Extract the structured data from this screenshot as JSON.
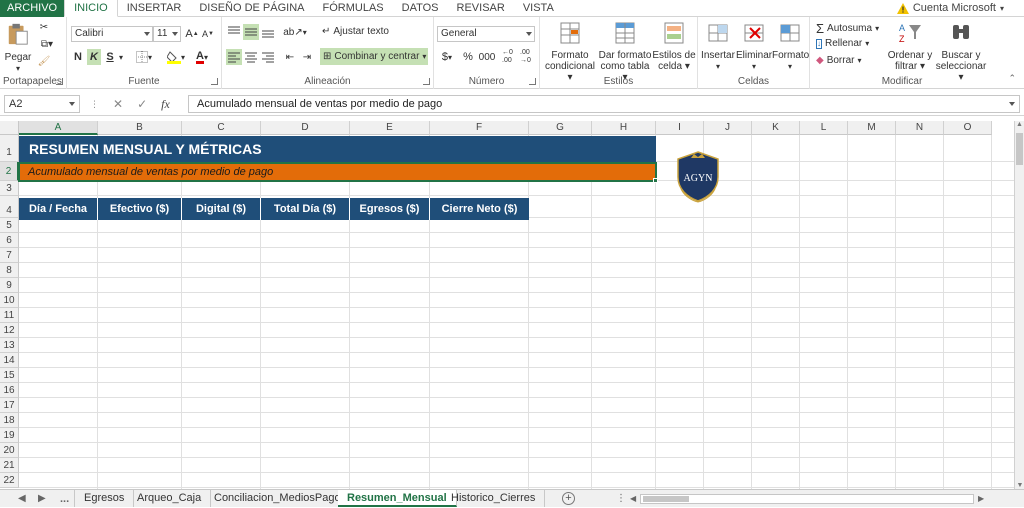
{
  "tabs": {
    "file": "ARCHIVO",
    "items": [
      "INICIO",
      "INSERTAR",
      "DISEÑO DE PÁGINA",
      "FÓRMULAS",
      "DATOS",
      "REVISAR",
      "VISTA"
    ],
    "active": "INICIO",
    "account": "Cuenta Microsoft"
  },
  "ribbon": {
    "clipboard": {
      "label": "Portapapeles",
      "paste": "Pegar"
    },
    "font": {
      "label": "Fuente",
      "font_name": "Calibri",
      "font_size": "11",
      "bold": "N",
      "italic": "K",
      "underline": "S"
    },
    "alignment": {
      "label": "Alineación",
      "wrap": "Ajustar texto",
      "merge": "Combinar y centrar"
    },
    "number": {
      "label": "Número",
      "format": "General",
      "currency": "$",
      "percent": "%",
      "thousands": "000",
      "inc": "←0 .00",
      "dec": ".00 →0"
    },
    "styles": {
      "label": "Estilos",
      "conditional": [
        "Formato",
        "condicional"
      ],
      "table": [
        "Dar formato",
        "como tabla"
      ],
      "cell_styles": [
        "Estilos de",
        "celda"
      ]
    },
    "cells": {
      "label": "Celdas",
      "insert": "Insertar",
      "delete": "Eliminar",
      "format": "Formato"
    },
    "editing": {
      "label": "Modificar",
      "autosum": "Autosuma",
      "fill": "Rellenar",
      "clear": "Borrar",
      "sort": [
        "Ordenar y",
        "filtrar"
      ],
      "find": [
        "Buscar y",
        "seleccionar"
      ]
    }
  },
  "formula_bar": {
    "name_box": "A2",
    "fx": "fx",
    "formula": "Acumulado mensual de ventas por medio de pago"
  },
  "sheet": {
    "columns": [
      "A",
      "B",
      "C",
      "D",
      "E",
      "F",
      "G",
      "H",
      "I",
      "J",
      "K",
      "L",
      "M",
      "N",
      "O"
    ],
    "rows": [
      "1",
      "2",
      "3",
      "4",
      "5",
      "6",
      "7",
      "8",
      "9",
      "10",
      "11",
      "12",
      "13",
      "14",
      "15",
      "16",
      "17",
      "18",
      "19",
      "20",
      "21",
      "22"
    ],
    "title": "RESUMEN MENSUAL Y MÉTRICAS",
    "subtitle": "Acumulado mensual de ventas por medio de pago",
    "headers": [
      "Día / Fecha",
      "Efectivo ($)",
      "Digital ($)",
      "Total Día ($)",
      "Egresos ($)",
      "Cierre Neto ($)"
    ],
    "logo_text": "AGYN",
    "colors": {
      "title_bg": "#1f4e79",
      "subtitle_bg": "#e36c09",
      "accent": "#217346"
    }
  },
  "sheet_tabs": {
    "items": [
      "Egresos",
      "Arqueo_Caja",
      "Conciliacion_MediosPago",
      "Resumen_Mensual",
      "Historico_Cierres"
    ],
    "active": "Resumen_Mensual",
    "more": "..."
  }
}
